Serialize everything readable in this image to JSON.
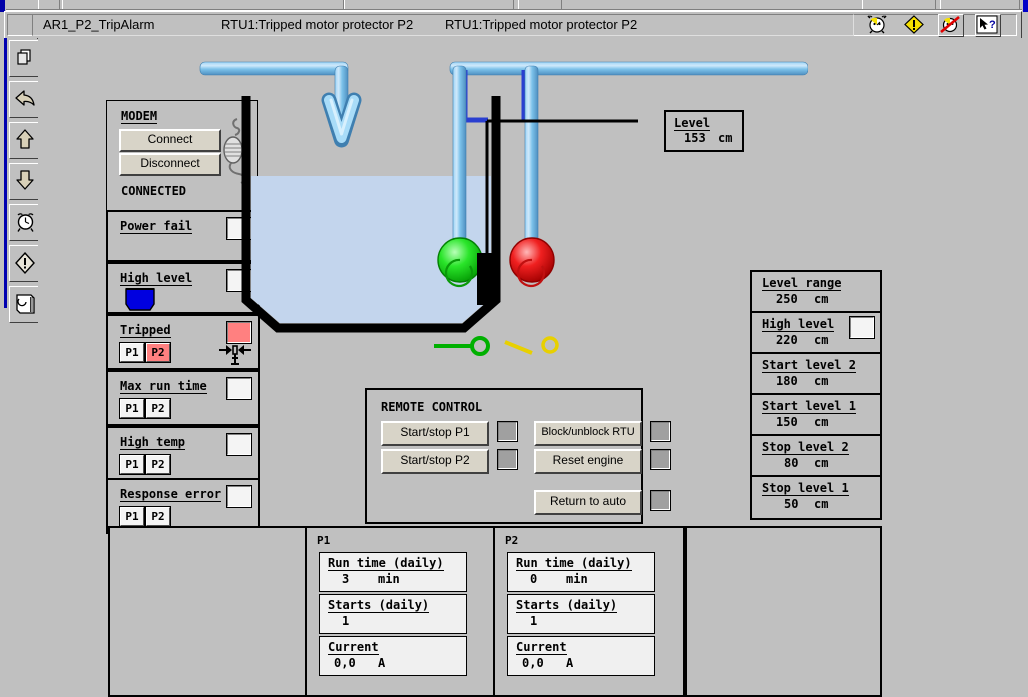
{
  "window": {
    "alarm_bar": {
      "tag": "AR1_P2_TripAlarm",
      "message_1": "RTU1:Tripped motor protector P2",
      "message_2": "RTU1:Tripped motor protector P2",
      "icons": [
        "alarm-clock-icon",
        "warning-diamond-icon",
        "alarm-muted-icon",
        "help-pointer-icon"
      ]
    }
  },
  "left_toolbar": {
    "items": [
      {
        "name": "copy-pages-icon"
      },
      {
        "name": "back-arrow-icon"
      },
      {
        "name": "up-arrow-icon"
      },
      {
        "name": "down-arrow-icon"
      },
      {
        "name": "alarm-clock-icon"
      },
      {
        "name": "warning-diamond-icon"
      },
      {
        "name": "report-icon"
      }
    ]
  },
  "modem": {
    "title": "MODEM",
    "connect_label": "Connect",
    "disconnect_label": "Disconnect",
    "status": "CONNECTED"
  },
  "alarms": [
    {
      "title": "Power fail",
      "lamp": "normal",
      "pumps": []
    },
    {
      "title": "High level",
      "lamp": "normal",
      "pumps": []
    },
    {
      "title": "Tripped",
      "lamp": "alarm",
      "pumps": [
        {
          "label": "P1",
          "state": "normal"
        },
        {
          "label": "P2",
          "state": "alarm"
        }
      ]
    },
    {
      "title": "Max run time",
      "lamp": "normal",
      "pumps": [
        {
          "label": "P1",
          "state": "normal"
        },
        {
          "label": "P2",
          "state": "normal"
        }
      ]
    },
    {
      "title": "High temp",
      "lamp": "normal",
      "pumps": [
        {
          "label": "P1",
          "state": "normal"
        },
        {
          "label": "P2",
          "state": "normal"
        }
      ]
    },
    {
      "title": "Response error",
      "lamp": "normal",
      "pumps": [
        {
          "label": "P1",
          "state": "normal"
        },
        {
          "label": "P2",
          "state": "normal"
        }
      ]
    }
  ],
  "tank": {
    "level_readout": {
      "title": "Level",
      "value": "153",
      "unit": "cm"
    },
    "pumps": [
      {
        "id": "P1",
        "color": "#00e000",
        "state": "running"
      },
      {
        "id": "P2",
        "color": "#f01010",
        "state": "stopped"
      }
    ],
    "switches": [
      {
        "name": "switch-closed-green",
        "color": "#00b000",
        "state": "closed"
      },
      {
        "name": "switch-open-yellow",
        "color": "#e8d000",
        "state": "open"
      }
    ],
    "water_color": "#c3d5ed",
    "pipe_color": "#8ec9f0"
  },
  "level_settings": [
    {
      "title": "Level range",
      "value": "250",
      "unit": "cm",
      "lamp": false
    },
    {
      "title": "High level",
      "value": "220",
      "unit": "cm",
      "lamp": true
    },
    {
      "title": "Start level 2",
      "value": "180",
      "unit": "cm",
      "lamp": false
    },
    {
      "title": "Start level 1",
      "value": "150",
      "unit": "cm",
      "lamp": false
    },
    {
      "title": "Stop level 2",
      "value": "80",
      "unit": "cm",
      "lamp": false
    },
    {
      "title": "Stop level 1",
      "value": "50",
      "unit": "cm",
      "lamp": false
    }
  ],
  "remote_control": {
    "title": "REMOTE  CONTROL",
    "buttons": [
      {
        "label": "Start/stop P1"
      },
      {
        "label": "Start/stop P2"
      },
      {
        "label": "Block/unblock RTU"
      },
      {
        "label": "Reset engine"
      },
      {
        "label": "Return to auto"
      }
    ]
  },
  "pump_stats": [
    {
      "title": "P1",
      "fields": [
        {
          "title": "Run time (daily)",
          "value": "3",
          "unit": "min"
        },
        {
          "title": "Starts (daily)",
          "value": "1",
          "unit": ""
        },
        {
          "title": "Current",
          "value": "0,0",
          "unit": "A"
        }
      ]
    },
    {
      "title": "P2",
      "fields": [
        {
          "title": "Run time (daily)",
          "value": "0",
          "unit": "min"
        },
        {
          "title": "Starts (daily)",
          "value": "1",
          "unit": ""
        },
        {
          "title": "Current",
          "value": "0,0",
          "unit": "A"
        }
      ]
    }
  ],
  "colors": {
    "face": "#c0c0c0",
    "alarm_red": "#ff8080",
    "pump_running": "#00e000",
    "pump_stopped": "#f01010",
    "water": "#c3d5ed",
    "pipe": "#8ec9f0",
    "high_level_icon": "#0000e0"
  }
}
